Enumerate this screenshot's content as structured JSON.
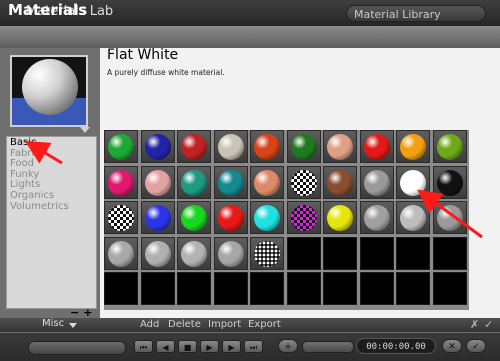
{
  "window": {
    "app_title": "Materials Lab",
    "library_tab": "Material Library"
  },
  "header": {
    "title": "Materials"
  },
  "material": {
    "name": "Flat White",
    "description": "A purely diffuse white material."
  },
  "categories": [
    "Basic",
    "Fabrics",
    "Food",
    "Funky",
    "Lights",
    "Organics",
    "Volumetrics"
  ],
  "category_controls": {
    "minus": "−",
    "plus": "+"
  },
  "bottom_bar": {
    "misc": "Misc",
    "actions": [
      "Add",
      "Delete",
      "Import",
      "Export"
    ],
    "close": "✗",
    "confirm": "✓"
  },
  "transport": {
    "time": "00:00:00.00"
  },
  "swatches": [
    [
      "#1fa834",
      "#2323a8",
      "#c02222",
      "#c8c3b4",
      "#d8431a",
      "#1f7a1f",
      "#e0a088",
      "#e31919",
      "#f2a010",
      "#6fa818"
    ],
    [
      "#e01870",
      "#e3a3a3",
      "#1e9a80",
      "#138a90",
      "#dc8a6a",
      "checker-bw",
      "#8a4e2e",
      "#9a9a9a",
      "#ffffff",
      "#111111"
    ],
    [
      "checker-bw",
      "#2a36e6",
      "#18d820",
      "#e81818",
      "#20e0e0",
      "checker-mg",
      "#e6e60a",
      "#a0a0a0",
      "#bdbdbd",
      "#9a9a9a"
    ],
    [
      "#a8a8a8",
      "#b0b0b0",
      "#b3b3b3",
      "#a6a6a6",
      "checker-dots",
      "",
      "",
      "",
      "",
      ""
    ],
    [
      "",
      "",
      "",
      "",
      "",
      "",
      "",
      "",
      "",
      ""
    ]
  ],
  "accent": {
    "arrow": "#ff1a1a"
  }
}
